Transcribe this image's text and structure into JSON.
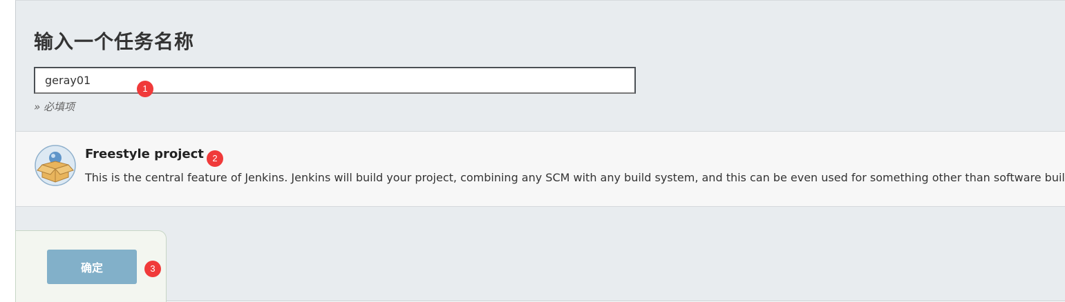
{
  "header": {
    "title": "输入一个任务名称"
  },
  "name_field": {
    "value": "geray01",
    "required_hint": "» 必填项"
  },
  "project_types": [
    {
      "title": "Freestyle project",
      "description": "This is the central feature of Jenkins. Jenkins will build your project, combining any SCM with any build system, and this can be even used for something other than software build.",
      "icon": "freestyle-project-icon"
    }
  ],
  "footer": {
    "ok_label": "确定"
  },
  "annotations": {
    "badge1": "1",
    "badge2": "2",
    "badge3": "3"
  },
  "colors": {
    "badge": "#f03a3a",
    "ok_button": "#82b0c9"
  }
}
